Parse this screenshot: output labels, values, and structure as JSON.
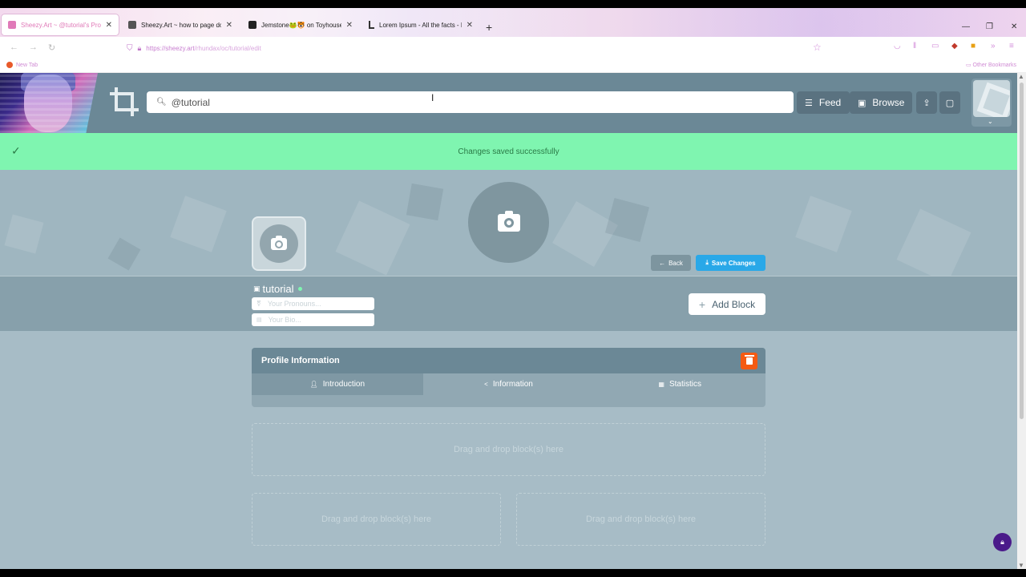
{
  "browser": {
    "tabs": [
      {
        "title": "Sheezy.Art ~ @tutorial's Profile",
        "active": true
      },
      {
        "title": "Sheezy.Art ~ how to page dolls",
        "active": false
      },
      {
        "title": "Jemstone🐸🐯 on Toyhouse",
        "active": false
      },
      {
        "title": "Lorem Ipsum - All the facts - Li",
        "active": false
      }
    ],
    "url_domain": "https://sheezy.art",
    "url_path": "/rhundax/oc/tutorial/edit",
    "bookmarks": {
      "new_tab": "New Tab",
      "other": "Other Bookmarks"
    }
  },
  "header": {
    "search_value": "@tutorial",
    "feed_label": "Feed",
    "browse_label": "Browse"
  },
  "toast": {
    "message": "Changes saved successfully"
  },
  "banner": {
    "back_label": "Back",
    "save_label": "Save Changes"
  },
  "profile": {
    "username": "tutorial",
    "pronouns_placeholder": "Your Pronouns...",
    "bio_placeholder": "Your Bio...",
    "add_block_label": "Add Block"
  },
  "card": {
    "title": "Profile Information",
    "tabs": [
      {
        "label": "Introduction",
        "icon": "person-icon",
        "active": true
      },
      {
        "label": "Information",
        "icon": "share-icon",
        "active": false
      },
      {
        "label": "Statistics",
        "icon": "table-icon",
        "active": false
      }
    ]
  },
  "dropzones": [
    "Drag and drop block(s) here",
    "Drag and drop block(s) here",
    "Drag and drop block(s) here"
  ],
  "colors": {
    "header": "#6b8896",
    "toast": "#7ff5b0",
    "save_button": "#29a8e8",
    "delete_button": "#f45a12",
    "page_bg": "#a7bcc6"
  }
}
